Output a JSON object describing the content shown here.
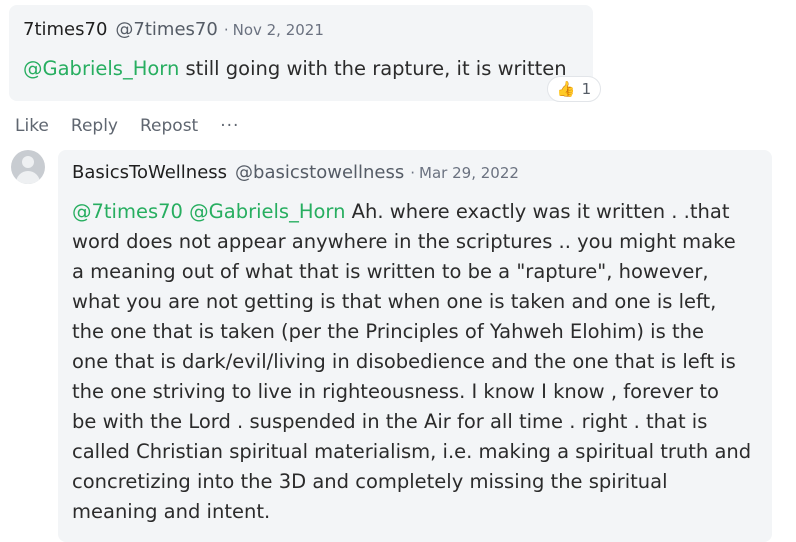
{
  "comment1": {
    "author": "7times70",
    "handle": "@7times70",
    "separator": "·",
    "date": "Nov 2, 2021",
    "mention": "@Gabriels_Horn",
    "text": " still going with the rapture, it is written",
    "reaction": {
      "icon": "thumbs-up-icon",
      "glyph": "👍",
      "count": "1"
    }
  },
  "actions": {
    "like": "Like",
    "reply": "Reply",
    "repost": "Repost",
    "more": "···"
  },
  "comment2": {
    "avatar_icon": "default-user-avatar",
    "author": "BasicsToWellness",
    "handle": "@basicstowellness",
    "separator": "·",
    "date": "Mar 29, 2022",
    "mention1": "@7times70",
    "mention2": "@Gabriels_Horn",
    "lines": [
      " Ah. where exactly was it written . .that",
      "word does not appear anywhere in the scriptures .. you might make",
      "a meaning out of what that is written to be a \"rapture\", however,",
      "what you are not getting is that when one is taken and one is left,",
      "the one that is taken (per the Principles of Yahweh Elohim) is the",
      "one that is dark/evil/living in disobedience and the one that is left is",
      "the one striving to live in righteousness. I know I know , forever to",
      "be with the Lord . suspended in the Air for all time . right . that is",
      "called Christian spiritual materialism, i.e. making a spiritual truth and",
      "concretizing into the 3D and completely missing the spiritual",
      "meaning and intent."
    ]
  },
  "colors": {
    "mention": "#27ae60",
    "bubble": "#f3f5f7",
    "text": "#2b2b2b",
    "muted": "#6b7280"
  }
}
